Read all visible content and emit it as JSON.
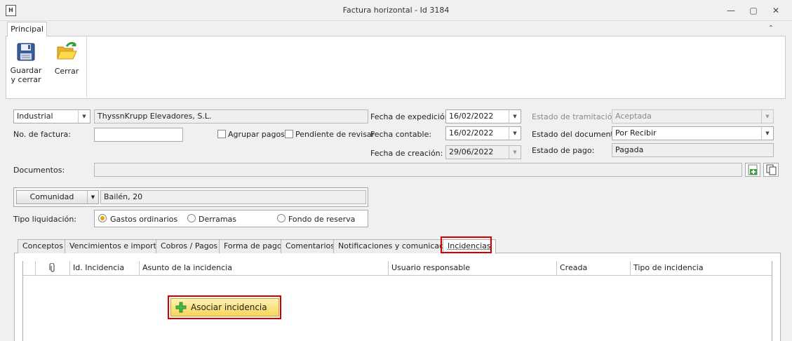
{
  "window": {
    "title": "Factura horizontal - Id 3184",
    "app_icon": "H",
    "minimize": "—",
    "restore": "▢",
    "close": "✕"
  },
  "ribbon": {
    "tab": "Principal",
    "collapse_glyph": "⌃",
    "save_label_1": "Guardar",
    "save_label_2": "y cerrar",
    "close_label": "Cerrar"
  },
  "header": {
    "type_select": "Industrial",
    "provider": "ThyssnKrupp Elevadores, S.L.",
    "invoice_no_label": "No. de factura:",
    "invoice_no_value": "",
    "group_payments_label": "Agrupar pagos",
    "pending_review_label": "Pendiente de revisar",
    "issue_date_label": "Fecha de expedición:",
    "issue_date": "16/02/2022",
    "accounting_date_label": "Fecha contable:",
    "accounting_date": "16/02/2022",
    "creation_date_label": "Fecha de creación:",
    "creation_date": "29/06/2022",
    "processing_state_label": "Estado de tramitación:",
    "processing_state": "Aceptada",
    "document_state_label": "Estado del documento:",
    "document_state": "Por Recibir",
    "payment_state_label": "Estado de pago:",
    "payment_state": "Pagada",
    "documents_label": "Documentos:",
    "documents_value": ""
  },
  "community": {
    "type_button": "Comunidad",
    "value": "Bailén, 20",
    "liquidation_label": "Tipo liquidación:",
    "options": [
      "Gastos ordinarios",
      "Derramas",
      "Fondo de reserva"
    ],
    "selected": "Gastos ordinarios"
  },
  "tabs": [
    "Conceptos",
    "Vencimientos e importes",
    "Cobros / Pagos",
    "Forma de pago",
    "Comentarios",
    "Notificaciones y comunicados",
    "Incidencias"
  ],
  "active_tab": "Incidencias",
  "grid": {
    "columns": [
      "",
      "",
      "Id. Incidencia",
      "Asunto de la incidencia",
      "Usuario responsable",
      "Creada",
      "Tipo de incidencia"
    ]
  },
  "associate_button": "Asociar incidencia",
  "colors": {
    "highlight": "#d40000",
    "button_gold": "#f7d45a",
    "radio_selected": "#e8a400"
  }
}
